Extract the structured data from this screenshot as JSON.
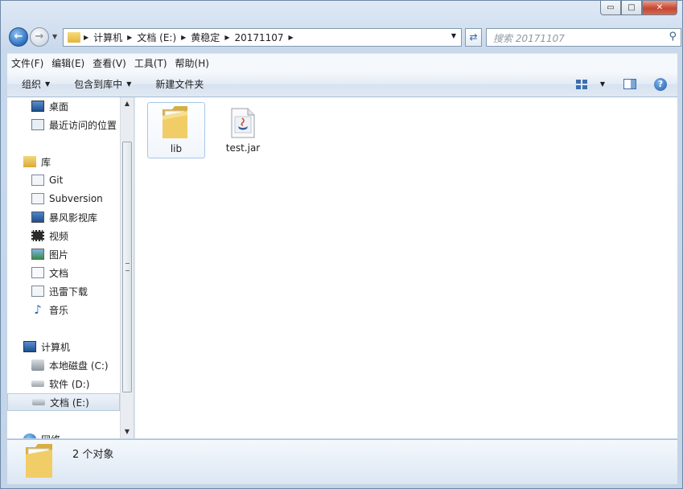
{
  "window": {
    "caption_buttons": {
      "minimize": "▭",
      "maximize": "□",
      "close": "✕"
    }
  },
  "address": {
    "crumbs": [
      "计算机",
      "文档 (E:)",
      "黄稳定",
      "20171107"
    ]
  },
  "search": {
    "placeholder": "搜索 20171107"
  },
  "menu": [
    "文件(F)",
    "编辑(E)",
    "查看(V)",
    "工具(T)",
    "帮助(H)"
  ],
  "commands": {
    "organize": "组织",
    "include_library": "包含到库中",
    "new_folder": "新建文件夹"
  },
  "nav": {
    "favorites": [
      {
        "label": "桌面",
        "icon": "desktop-icon"
      },
      {
        "label": "最近访问的位置",
        "icon": "recent-places-icon"
      }
    ],
    "libraries_header": "库",
    "libraries": [
      {
        "label": "Git",
        "icon": "git-library-icon"
      },
      {
        "label": "Subversion",
        "icon": "document-library-icon"
      },
      {
        "label": "暴风影视库",
        "icon": "video-library-icon"
      },
      {
        "label": "视频",
        "icon": "video-icon"
      },
      {
        "label": "图片",
        "icon": "picture-icon"
      },
      {
        "label": "文档",
        "icon": "document-icon"
      },
      {
        "label": "迅雷下载",
        "icon": "download-icon"
      },
      {
        "label": "音乐",
        "icon": "music-icon"
      }
    ],
    "computer_header": "计算机",
    "drives": [
      {
        "label": "本地磁盘 (C:)",
        "icon": "system-drive-icon"
      },
      {
        "label": "软件 (D:)",
        "icon": "drive-icon"
      },
      {
        "label": "文档 (E:)",
        "icon": "drive-icon",
        "selected": true
      }
    ],
    "network_header": "网络"
  },
  "files": [
    {
      "name": "lib",
      "type": "folder",
      "selected": true
    },
    {
      "name": "test.jar",
      "type": "jar"
    }
  ],
  "status": {
    "count": "2 个对象"
  },
  "colors": {
    "folder": "#e8c25a",
    "accent": "#2a6fc0",
    "selection": "#a6c7ea"
  }
}
